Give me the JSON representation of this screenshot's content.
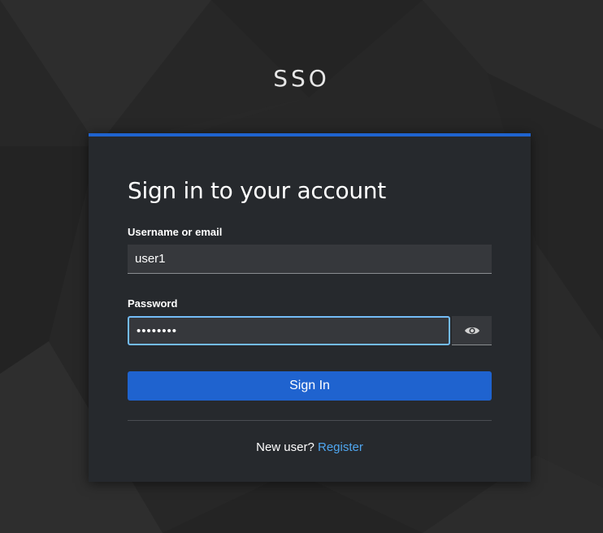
{
  "brand": {
    "name": "SSO"
  },
  "login": {
    "title": "Sign in to your account",
    "username_label": "Username or email",
    "username_value": "user1",
    "password_label": "Password",
    "password_value": "••••••••",
    "show_password_icon": "eye-icon",
    "submit_label": "Sign In",
    "new_user_text": "New user?",
    "register_label": "Register"
  },
  "colors": {
    "accent": "#1f63cf",
    "link": "#4fa6f0",
    "focus_border": "#73bcf7",
    "card_bg": "#26292d",
    "input_bg": "#36383c"
  }
}
